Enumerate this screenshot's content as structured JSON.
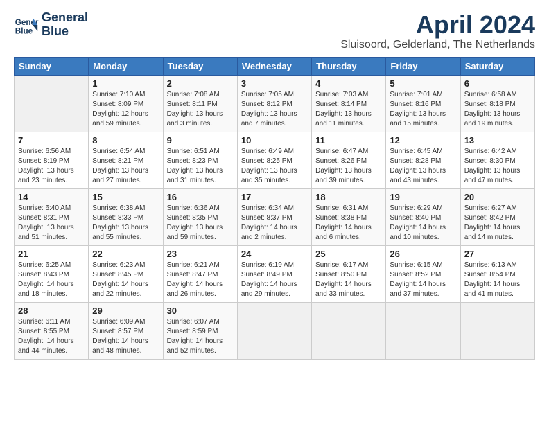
{
  "header": {
    "logo_line1": "General",
    "logo_line2": "Blue",
    "month_title": "April 2024",
    "location": "Sluisoord, Gelderland, The Netherlands"
  },
  "weekdays": [
    "Sunday",
    "Monday",
    "Tuesday",
    "Wednesday",
    "Thursday",
    "Friday",
    "Saturday"
  ],
  "weeks": [
    [
      {
        "day": "",
        "detail": ""
      },
      {
        "day": "1",
        "detail": "Sunrise: 7:10 AM\nSunset: 8:09 PM\nDaylight: 12 hours\nand 59 minutes."
      },
      {
        "day": "2",
        "detail": "Sunrise: 7:08 AM\nSunset: 8:11 PM\nDaylight: 13 hours\nand 3 minutes."
      },
      {
        "day": "3",
        "detail": "Sunrise: 7:05 AM\nSunset: 8:12 PM\nDaylight: 13 hours\nand 7 minutes."
      },
      {
        "day": "4",
        "detail": "Sunrise: 7:03 AM\nSunset: 8:14 PM\nDaylight: 13 hours\nand 11 minutes."
      },
      {
        "day": "5",
        "detail": "Sunrise: 7:01 AM\nSunset: 8:16 PM\nDaylight: 13 hours\nand 15 minutes."
      },
      {
        "day": "6",
        "detail": "Sunrise: 6:58 AM\nSunset: 8:18 PM\nDaylight: 13 hours\nand 19 minutes."
      }
    ],
    [
      {
        "day": "7",
        "detail": "Sunrise: 6:56 AM\nSunset: 8:19 PM\nDaylight: 13 hours\nand 23 minutes."
      },
      {
        "day": "8",
        "detail": "Sunrise: 6:54 AM\nSunset: 8:21 PM\nDaylight: 13 hours\nand 27 minutes."
      },
      {
        "day": "9",
        "detail": "Sunrise: 6:51 AM\nSunset: 8:23 PM\nDaylight: 13 hours\nand 31 minutes."
      },
      {
        "day": "10",
        "detail": "Sunrise: 6:49 AM\nSunset: 8:25 PM\nDaylight: 13 hours\nand 35 minutes."
      },
      {
        "day": "11",
        "detail": "Sunrise: 6:47 AM\nSunset: 8:26 PM\nDaylight: 13 hours\nand 39 minutes."
      },
      {
        "day": "12",
        "detail": "Sunrise: 6:45 AM\nSunset: 8:28 PM\nDaylight: 13 hours\nand 43 minutes."
      },
      {
        "day": "13",
        "detail": "Sunrise: 6:42 AM\nSunset: 8:30 PM\nDaylight: 13 hours\nand 47 minutes."
      }
    ],
    [
      {
        "day": "14",
        "detail": "Sunrise: 6:40 AM\nSunset: 8:31 PM\nDaylight: 13 hours\nand 51 minutes."
      },
      {
        "day": "15",
        "detail": "Sunrise: 6:38 AM\nSunset: 8:33 PM\nDaylight: 13 hours\nand 55 minutes."
      },
      {
        "day": "16",
        "detail": "Sunrise: 6:36 AM\nSunset: 8:35 PM\nDaylight: 13 hours\nand 59 minutes."
      },
      {
        "day": "17",
        "detail": "Sunrise: 6:34 AM\nSunset: 8:37 PM\nDaylight: 14 hours\nand 2 minutes."
      },
      {
        "day": "18",
        "detail": "Sunrise: 6:31 AM\nSunset: 8:38 PM\nDaylight: 14 hours\nand 6 minutes."
      },
      {
        "day": "19",
        "detail": "Sunrise: 6:29 AM\nSunset: 8:40 PM\nDaylight: 14 hours\nand 10 minutes."
      },
      {
        "day": "20",
        "detail": "Sunrise: 6:27 AM\nSunset: 8:42 PM\nDaylight: 14 hours\nand 14 minutes."
      }
    ],
    [
      {
        "day": "21",
        "detail": "Sunrise: 6:25 AM\nSunset: 8:43 PM\nDaylight: 14 hours\nand 18 minutes."
      },
      {
        "day": "22",
        "detail": "Sunrise: 6:23 AM\nSunset: 8:45 PM\nDaylight: 14 hours\nand 22 minutes."
      },
      {
        "day": "23",
        "detail": "Sunrise: 6:21 AM\nSunset: 8:47 PM\nDaylight: 14 hours\nand 26 minutes."
      },
      {
        "day": "24",
        "detail": "Sunrise: 6:19 AM\nSunset: 8:49 PM\nDaylight: 14 hours\nand 29 minutes."
      },
      {
        "day": "25",
        "detail": "Sunrise: 6:17 AM\nSunset: 8:50 PM\nDaylight: 14 hours\nand 33 minutes."
      },
      {
        "day": "26",
        "detail": "Sunrise: 6:15 AM\nSunset: 8:52 PM\nDaylight: 14 hours\nand 37 minutes."
      },
      {
        "day": "27",
        "detail": "Sunrise: 6:13 AM\nSunset: 8:54 PM\nDaylight: 14 hours\nand 41 minutes."
      }
    ],
    [
      {
        "day": "28",
        "detail": "Sunrise: 6:11 AM\nSunset: 8:55 PM\nDaylight: 14 hours\nand 44 minutes."
      },
      {
        "day": "29",
        "detail": "Sunrise: 6:09 AM\nSunset: 8:57 PM\nDaylight: 14 hours\nand 48 minutes."
      },
      {
        "day": "30",
        "detail": "Sunrise: 6:07 AM\nSunset: 8:59 PM\nDaylight: 14 hours\nand 52 minutes."
      },
      {
        "day": "",
        "detail": ""
      },
      {
        "day": "",
        "detail": ""
      },
      {
        "day": "",
        "detail": ""
      },
      {
        "day": "",
        "detail": ""
      }
    ]
  ]
}
